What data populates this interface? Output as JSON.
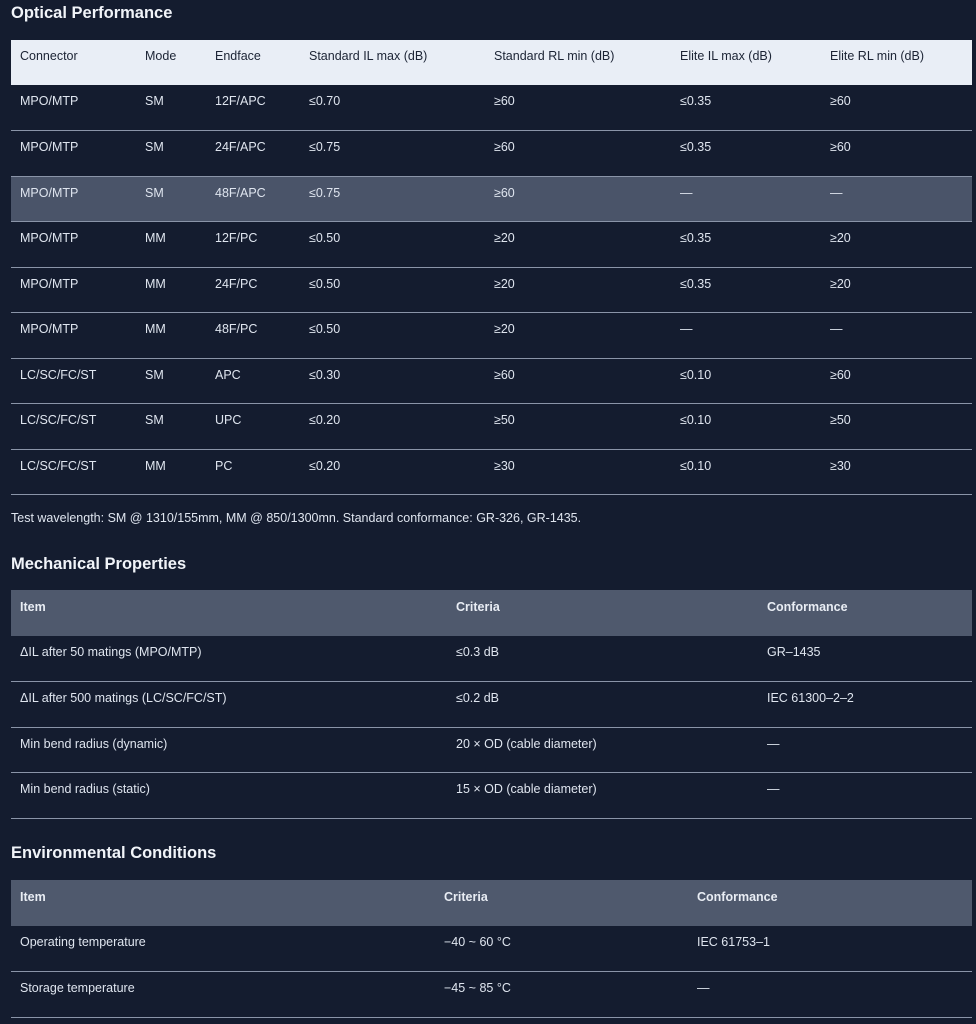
{
  "optical": {
    "title": "Optical Performance",
    "headers": [
      "Connector",
      "Mode",
      "Endface",
      "Standard IL max (dB)",
      "Standard RL min (dB)",
      "Elite IL max (dB)",
      "Elite RL min (dB)"
    ],
    "rows": [
      [
        "MPO/MTP",
        "SM",
        "12F/APC",
        "≤0.70",
        "≥60",
        "≤0.35",
        "≥60"
      ],
      [
        "MPO/MTP",
        "SM",
        "24F/APC",
        "≤0.75",
        "≥60",
        "≤0.35",
        "≥60"
      ],
      [
        "MPO/MTP",
        "SM",
        "48F/APC",
        "≤0.75",
        "≥60",
        "—",
        "—"
      ],
      [
        "MPO/MTP",
        "MM",
        "12F/PC",
        "≤0.50",
        "≥20",
        "≤0.35",
        "≥20"
      ],
      [
        "MPO/MTP",
        "MM",
        "24F/PC",
        "≤0.50",
        "≥20",
        "≤0.35",
        "≥20"
      ],
      [
        "MPO/MTP",
        "MM",
        "48F/PC",
        "≤0.50",
        "≥20",
        "—",
        "—"
      ],
      [
        "LC/SC/FC/ST",
        "SM",
        "APC",
        "≤0.30",
        "≥60",
        "≤0.10",
        "≥60"
      ],
      [
        "LC/SC/FC/ST",
        "SM",
        "UPC",
        "≤0.20",
        "≥50",
        "≤0.10",
        "≥50"
      ],
      [
        "LC/SC/FC/ST",
        "MM",
        "PC",
        "≤0.20",
        "≥30",
        "≤0.10",
        "≥30"
      ]
    ],
    "note": "Test wavelength: SM @ 1310/155mm, MM @ 850/1300mn. Standard conformance: GR-326, GR-1435."
  },
  "mechanical": {
    "title": "Mechanical Properties",
    "headers": [
      "Item",
      "Criteria",
      "Conformance"
    ],
    "rows": [
      [
        "ΔIL after 50 matings (MPO/MTP)",
        "≤0.3 dB",
        "GR–1435"
      ],
      [
        "ΔIL after 500 matings (LC/SC/FC/ST)",
        "≤0.2 dB",
        "IEC 61300–2–2"
      ],
      [
        "Min bend radius (dynamic)",
        "20 × OD (cable diameter)",
        "—"
      ],
      [
        "Min bend radius (static)",
        "15 × OD (cable diameter)",
        "—"
      ]
    ]
  },
  "environmental": {
    "title": "Environmental Conditions",
    "headers": [
      "Item",
      "Criteria",
      "Conformance"
    ],
    "rows": [
      [
        "Operating temperature",
        "−40 ~ 60 °C",
        "IEC 61753–1"
      ],
      [
        "Storage temperature",
        "−45 ~ 85 °C",
        "—"
      ]
    ]
  },
  "colors": {
    "background": "#141c2f",
    "optical_header_bg": "#e9eef6",
    "section_header_bg": "#4f596d",
    "highlight_row_bg": "#4a5469"
  }
}
